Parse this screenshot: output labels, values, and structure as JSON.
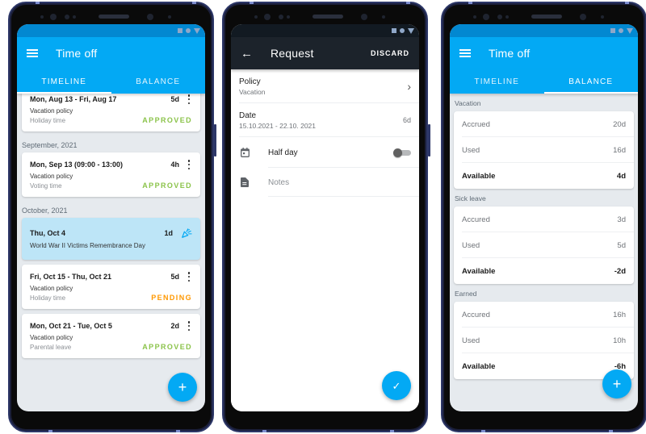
{
  "screens": {
    "timeline": {
      "title": "Time off",
      "tabs": [
        {
          "label": "TIMELINE",
          "active": true
        },
        {
          "label": "BALANCE",
          "active": false
        }
      ],
      "groups": [
        {
          "month": "",
          "entries": [
            {
              "range": "Mon, Aug 13 - Fri, Aug 17",
              "duration": "5d",
              "policy": "Vacation policy",
              "subtype": "Holiday time",
              "status": "APPROVED",
              "status_type": "approved"
            }
          ]
        },
        {
          "month": "September, 2021",
          "entries": [
            {
              "range": "Mon, Sep 13 (09:00 - 13:00)",
              "duration": "4h",
              "policy": "Vacation policy",
              "subtype": "Voting time",
              "status": "APPROVED",
              "status_type": "approved"
            }
          ]
        },
        {
          "month": "October, 2021",
          "holiday": {
            "date": "Thu, Oct 4",
            "duration": "1d",
            "name": "World War II Victims Remembrance Day",
            "icon": "party-popper-icon"
          },
          "entries": [
            {
              "range": "Fri, Oct 15 - Thu, Oct 21",
              "duration": "5d",
              "policy": "Vacation policy",
              "subtype": "Holiday time",
              "status": "PENDING",
              "status_type": "pending"
            },
            {
              "range": "Mon, Oct 21 - Tue, Oct 5",
              "duration": "2d",
              "policy": "Vacation policy",
              "subtype": "Parental leave",
              "status": "APPROVED",
              "status_type": "approved"
            }
          ]
        }
      ],
      "fab_icon": "+"
    },
    "request": {
      "title": "Request",
      "back_icon": "←",
      "discard_label": "DISCARD",
      "policy": {
        "label": "Policy",
        "value": "Vacation",
        "chevron": "›"
      },
      "date": {
        "label": "Date",
        "value": "15.10.2021 - 22.10. 2021",
        "duration": "6d"
      },
      "half_day": {
        "label": "Half day",
        "enabled": false
      },
      "notes": {
        "placeholder": "Notes"
      },
      "fab_icon": "✓"
    },
    "balance": {
      "title": "Time off",
      "tabs": [
        {
          "label": "TIMELINE",
          "active": false
        },
        {
          "label": "BALANCE",
          "active": true
        }
      ],
      "sections": [
        {
          "title": "Vacation",
          "rows": [
            {
              "label": "Accrued",
              "value": "20d"
            },
            {
              "label": "Used",
              "value": "16d"
            },
            {
              "label": "Available",
              "value": "4d",
              "total": true
            }
          ]
        },
        {
          "title": "Sick leave",
          "rows": [
            {
              "label": "Accured",
              "value": "3d"
            },
            {
              "label": "Used",
              "value": "5d"
            },
            {
              "label": "Available",
              "value": "-2d",
              "total": true
            }
          ]
        },
        {
          "title": "Earned",
          "rows": [
            {
              "label": "Accured",
              "value": "16h"
            },
            {
              "label": "Used",
              "value": "10h"
            },
            {
              "label": "Available",
              "value": "-6h",
              "total": true
            }
          ]
        }
      ],
      "fab_icon": "+"
    }
  },
  "colors": {
    "primary": "#03a9f4",
    "primary_dark": "#0288d1",
    "dark_appbar": "#1c232b",
    "approved": "#8bc34a",
    "pending": "#ff9800",
    "holiday_bg": "#bde5f7",
    "background": "#e6eaee"
  }
}
